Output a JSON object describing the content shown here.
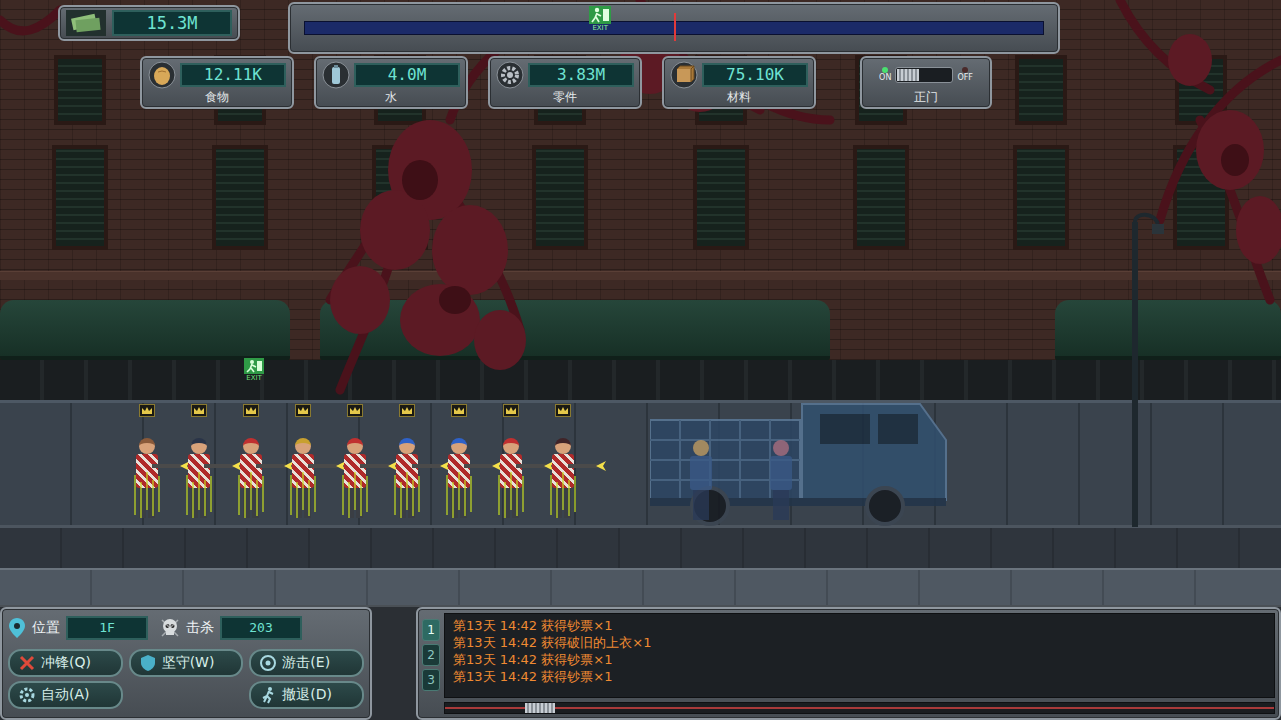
{
  "money": {
    "value": "15.3M"
  },
  "progress": {
    "exit_label": "EXIT",
    "exit_level": 0.4,
    "marker_level": 0.5
  },
  "resources": [
    {
      "label": "食物",
      "value": "12.11K"
    },
    {
      "label": "水",
      "value": "4.0M"
    },
    {
      "label": "零件",
      "value": "3.83M"
    },
    {
      "label": "材料",
      "value": "75.10K"
    }
  ],
  "gate": {
    "label": "正门",
    "on_label": "ON",
    "off_label": "OFF",
    "on": true
  },
  "scene": {
    "exit_sign": "EXIT",
    "squad": [
      {
        "color": "#8a5a3a"
      },
      {
        "color": "#2a3448"
      },
      {
        "color": "#c03030"
      },
      {
        "color": "#c8a030"
      },
      {
        "color": "#c03030"
      },
      {
        "color": "#2f62c8"
      },
      {
        "color": "#2f62c8"
      },
      {
        "color": "#c03030"
      },
      {
        "color": "#402428"
      }
    ],
    "enemies": [
      {
        "color": "#c8a060"
      },
      {
        "color": "#b07080"
      }
    ]
  },
  "status": {
    "location_label": "位置",
    "location": "1F",
    "kills_label": "击杀",
    "kills": "203"
  },
  "commands": [
    {
      "label": "冲锋(Q)",
      "selected": false
    },
    {
      "label": "坚守(W)",
      "selected": false
    },
    {
      "label": "游击(E)",
      "selected": false
    },
    {
      "label": "自动(A)",
      "selected": false
    },
    {
      "label": "撤退(D)",
      "selected": false
    }
  ],
  "log": {
    "tabs": [
      {
        "label": "1",
        "selected": true
      },
      {
        "label": "2",
        "selected": false
      },
      {
        "label": "3",
        "selected": false
      }
    ],
    "lines": [
      "第13天 14:42 获得钞票×1",
      "第13天 14:42 获得破旧的上衣×1",
      "第13天 14:42 获得钞票×1",
      "第13天 14:42 获得钞票×1"
    ],
    "scroll_level": 0.1
  }
}
